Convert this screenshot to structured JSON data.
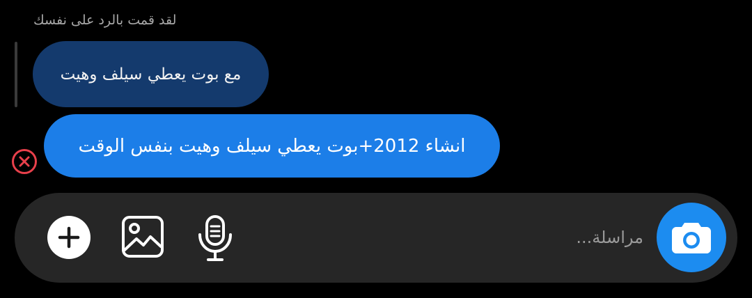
{
  "thread": {
    "reply_label": "لقد قمت بالرد على نفسك",
    "quoted_message": "مع بوت يعطي سيلف وهيت",
    "message": "انشاء 2012+بوت يعطي سيلف وهيت بنفس الوقت",
    "status": "failed"
  },
  "composer": {
    "placeholder": "مراسلة..."
  },
  "icons": {
    "error": "error-x-icon",
    "plus": "plus-icon",
    "gallery": "image-icon",
    "mic": "microphone-icon",
    "camera": "camera-icon"
  },
  "colors": {
    "background": "#000000",
    "quoted_bubble": "#143a6d",
    "message_bubble": "#1c7ee8",
    "composer_bg": "#262626",
    "camera_button": "#1c8cf0",
    "error": "#e8404b"
  }
}
